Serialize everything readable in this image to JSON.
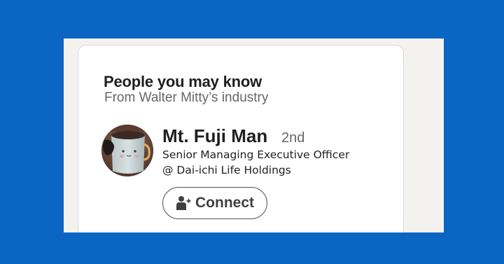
{
  "card": {
    "title": "People you may know",
    "subtitle": "From Walter Mitty’s industry"
  },
  "person": {
    "name": "Mt. Fuji Man",
    "degree": "2nd",
    "headline_line1": "Senior Managing Executive Officer",
    "headline_line2": "@ Dai-ichi Life Holdings",
    "avatar_icon": "avatar-photo"
  },
  "actions": {
    "connect_label": "Connect",
    "connect_icon": "add-person-icon"
  },
  "colors": {
    "background": "#0a66c2",
    "card": "#ffffff",
    "panel": "#f4f2ee",
    "text_primary": "#1f1f1f",
    "text_secondary": "#666666"
  }
}
